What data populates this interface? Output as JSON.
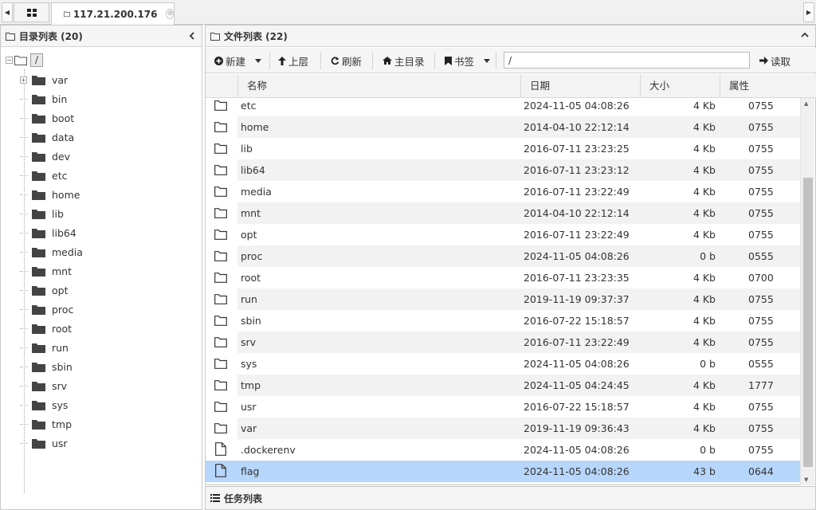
{
  "tabs": {
    "site_label": "117.21.200.176",
    "close_symbol": "⊗"
  },
  "dir_panel": {
    "title": "目录列表 (20)",
    "root_label": "/",
    "expander_plus": "+",
    "expander_minus": "−",
    "items": [
      "var",
      "bin",
      "boot",
      "data",
      "dev",
      "etc",
      "home",
      "lib",
      "lib64",
      "media",
      "mnt",
      "opt",
      "proc",
      "root",
      "run",
      "sbin",
      "srv",
      "sys",
      "tmp",
      "usr"
    ]
  },
  "file_panel": {
    "title": "文件列表 (22)",
    "toolbar": {
      "new_label": "新建",
      "up_label": "上层",
      "refresh_label": "刷新",
      "home_label": "主目录",
      "bookmark_label": "书签",
      "path_value": "/",
      "read_label": "读取"
    },
    "columns": {
      "name": "名称",
      "date": "日期",
      "size": "大小",
      "attr": "属性"
    },
    "rows": [
      {
        "type": "folder",
        "name": "etc",
        "date": "2024-11-05 04:08:26",
        "size": "4 Kb",
        "attr": "0755"
      },
      {
        "type": "folder",
        "name": "home",
        "date": "2014-04-10 22:12:14",
        "size": "4 Kb",
        "attr": "0755"
      },
      {
        "type": "folder",
        "name": "lib",
        "date": "2016-07-11 23:23:25",
        "size": "4 Kb",
        "attr": "0755"
      },
      {
        "type": "folder",
        "name": "lib64",
        "date": "2016-07-11 23:23:12",
        "size": "4 Kb",
        "attr": "0755"
      },
      {
        "type": "folder",
        "name": "media",
        "date": "2016-07-11 23:22:49",
        "size": "4 Kb",
        "attr": "0755"
      },
      {
        "type": "folder",
        "name": "mnt",
        "date": "2014-04-10 22:12:14",
        "size": "4 Kb",
        "attr": "0755"
      },
      {
        "type": "folder",
        "name": "opt",
        "date": "2016-07-11 23:22:49",
        "size": "4 Kb",
        "attr": "0755"
      },
      {
        "type": "folder",
        "name": "proc",
        "date": "2024-11-05 04:08:26",
        "size": "0 b",
        "attr": "0555"
      },
      {
        "type": "folder",
        "name": "root",
        "date": "2016-07-11 23:23:35",
        "size": "4 Kb",
        "attr": "0700"
      },
      {
        "type": "folder",
        "name": "run",
        "date": "2019-11-19 09:37:37",
        "size": "4 Kb",
        "attr": "0755"
      },
      {
        "type": "folder",
        "name": "sbin",
        "date": "2016-07-22 15:18:57",
        "size": "4 Kb",
        "attr": "0755"
      },
      {
        "type": "folder",
        "name": "srv",
        "date": "2016-07-11 23:22:49",
        "size": "4 Kb",
        "attr": "0755"
      },
      {
        "type": "folder",
        "name": "sys",
        "date": "2024-11-05 04:08:26",
        "size": "0 b",
        "attr": "0555"
      },
      {
        "type": "folder",
        "name": "tmp",
        "date": "2024-11-05 04:24:45",
        "size": "4 Kb",
        "attr": "1777"
      },
      {
        "type": "folder",
        "name": "usr",
        "date": "2016-07-22 15:18:57",
        "size": "4 Kb",
        "attr": "0755"
      },
      {
        "type": "folder",
        "name": "var",
        "date": "2019-11-19 09:36:43",
        "size": "4 Kb",
        "attr": "0755"
      },
      {
        "type": "file",
        "name": ".dockerenv",
        "date": "2024-11-05 04:08:26",
        "size": "0 b",
        "attr": "0755"
      },
      {
        "type": "file",
        "name": "flag",
        "date": "2024-11-05 04:08:26",
        "size": "43 b",
        "attr": "0644",
        "selected": true
      }
    ]
  },
  "task_panel": {
    "title": "任务列表"
  },
  "colors": {
    "selected_row": "#b7d6fb",
    "alt_row": "#f2f2f2",
    "panel_header": "#f5f5f5",
    "border": "#c8c8c8",
    "folder_icon": "#444444"
  }
}
